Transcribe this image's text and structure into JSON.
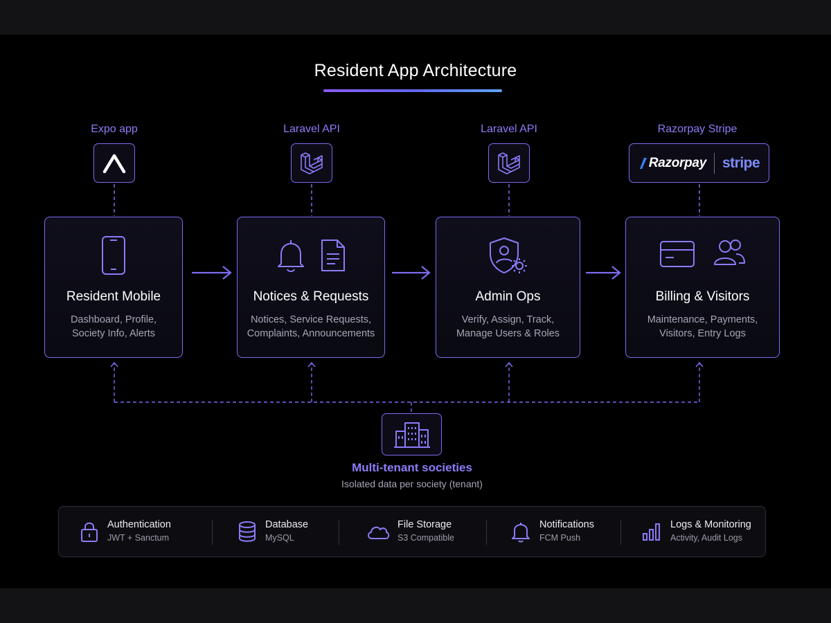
{
  "title": "Resident App Architecture",
  "tech": [
    {
      "label": "Expo app",
      "icon": "expo-logo-icon"
    },
    {
      "label": "Laravel API",
      "icon": "laravel-logo-icon"
    },
    {
      "label": "Laravel API",
      "icon": "laravel-logo-icon"
    },
    {
      "label": "Razorpay Stripe",
      "razorpay": "Razorpay",
      "stripe": "stripe"
    }
  ],
  "cards": [
    {
      "title": "Resident Mobile",
      "desc": [
        "Dashboard, Profile,",
        "Society Info, Alerts"
      ],
      "icons": [
        "smartphone-icon"
      ]
    },
    {
      "title": "Notices & Requests",
      "desc": [
        "Notices, Service Requests,",
        "Complaints, Announcements"
      ],
      "icons": [
        "bell-icon",
        "document-icon"
      ]
    },
    {
      "title": "Admin Ops",
      "desc": [
        "Verify, Assign, Track,",
        "Manage Users & Roles"
      ],
      "icons": [
        "user-shield-gear-icon"
      ]
    },
    {
      "title": "Billing & Visitors",
      "desc": [
        "Maintenance, Payments,",
        "Visitors, Entry Logs"
      ],
      "icons": [
        "credit-card-icon",
        "users-icon"
      ]
    }
  ],
  "tenant": {
    "title": "Multi-tenant societies",
    "subtitle": "Isolated data per society (tenant)",
    "icon": "buildings-icon"
  },
  "footer": [
    {
      "title": "Authentication",
      "subtitle": "JWT + Sanctum",
      "icon": "lock-icon"
    },
    {
      "title": "Database",
      "subtitle": "MySQL",
      "icon": "database-icon"
    },
    {
      "title": "File Storage",
      "subtitle": "S3 Compatible",
      "icon": "cloud-icon"
    },
    {
      "title": "Notifications",
      "subtitle": "FCM Push",
      "icon": "bell-icon"
    },
    {
      "title": "Logs & Monitoring",
      "subtitle": "Activity, Audit Logs",
      "icon": "bar-chart-icon"
    }
  ],
  "colors": {
    "accent": "#7c6cf0",
    "label": "#8b7cf8",
    "background": "#000000"
  }
}
